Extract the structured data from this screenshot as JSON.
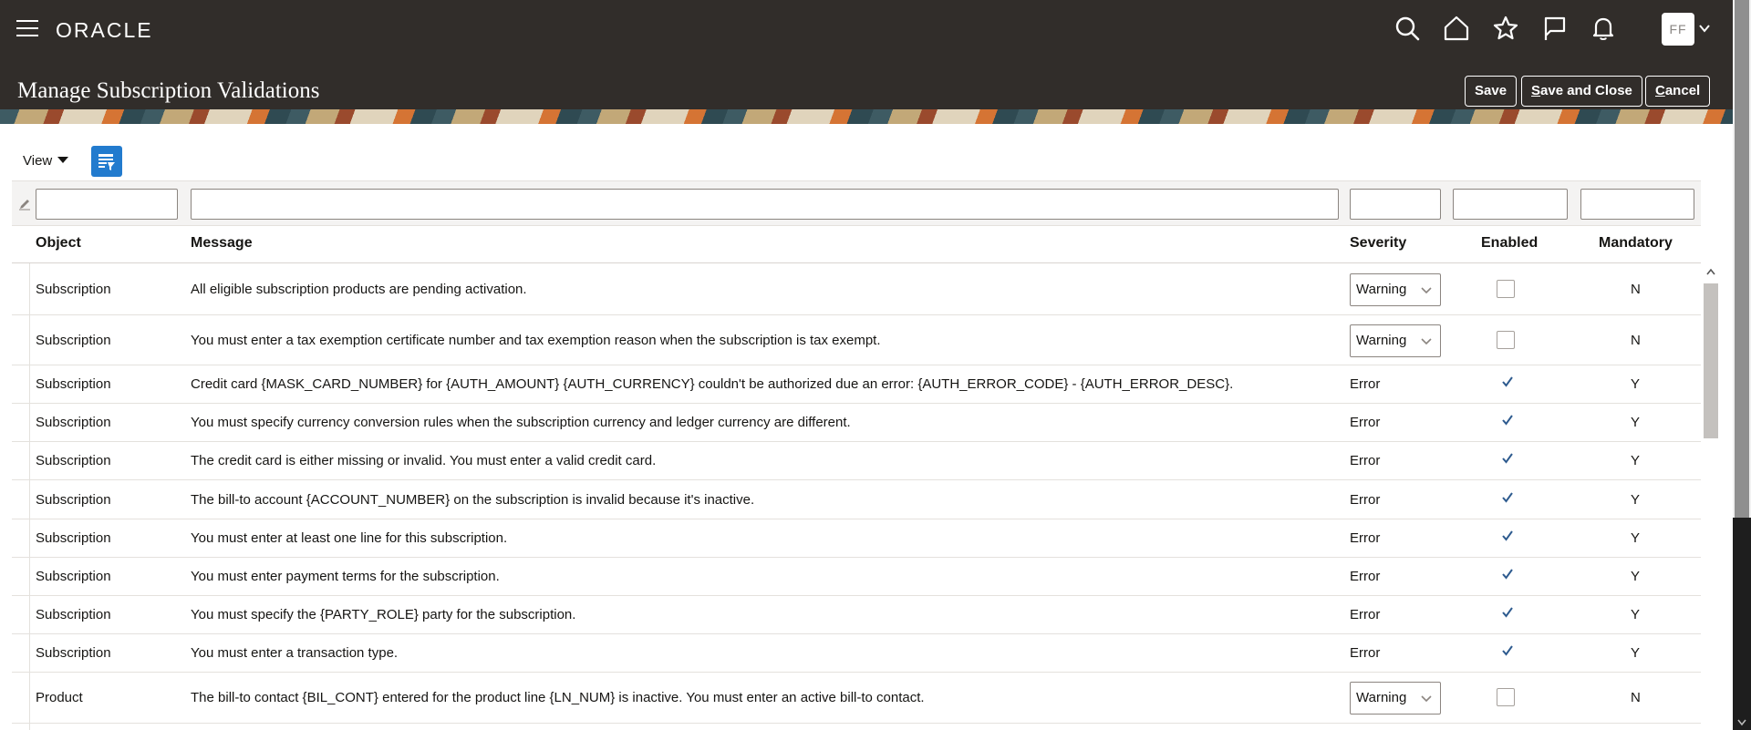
{
  "header": {
    "logo_text": "ORACLE",
    "page_title": "Manage Subscription Validations",
    "avatar_initials": "FF",
    "buttons": {
      "save": "Save",
      "save_and_close_first": "S",
      "save_and_close_rest": "ave and Close",
      "cancel_first": "C",
      "cancel_rest": "ancel"
    },
    "icons": [
      "menu-icon",
      "search-icon",
      "home-icon",
      "favorites-star-icon",
      "flag-icon",
      "notifications-bell-icon",
      "chevron-down-icon"
    ]
  },
  "toolbar": {
    "view_label": "View",
    "freeze_icon": "freeze-columns-icon"
  },
  "table": {
    "columns": {
      "object": "Object",
      "message": "Message",
      "severity": "Severity",
      "enabled": "Enabled",
      "mandatory": "Mandatory"
    },
    "filters": {
      "object": "",
      "message": "",
      "severity": "",
      "enabled": "",
      "mandatory": ""
    },
    "rows": [
      {
        "object": "Subscription",
        "message": "All eligible subscription products are pending activation.",
        "severity": "Warning",
        "severity_editable": true,
        "enabled": false,
        "mandatory": "N"
      },
      {
        "object": "Subscription",
        "message": "You must enter a tax exemption certificate number and tax exemption reason when the subscription is tax exempt.",
        "severity": "Warning",
        "severity_editable": true,
        "enabled": false,
        "mandatory": "N"
      },
      {
        "object": "Subscription",
        "message": "Credit card {MASK_CARD_NUMBER} for {AUTH_AMOUNT} {AUTH_CURRENCY} couldn't be authorized due an error: {AUTH_ERROR_CODE} - {AUTH_ERROR_DESC}.",
        "severity": "Error",
        "severity_editable": false,
        "enabled": true,
        "mandatory": "Y"
      },
      {
        "object": "Subscription",
        "message": "You must specify currency conversion rules when the subscription currency and ledger currency are different.",
        "severity": "Error",
        "severity_editable": false,
        "enabled": true,
        "mandatory": "Y"
      },
      {
        "object": "Subscription",
        "message": "The credit card is either missing or invalid. You must enter a valid credit card.",
        "severity": "Error",
        "severity_editable": false,
        "enabled": true,
        "mandatory": "Y"
      },
      {
        "object": "Subscription",
        "message": "The bill-to account {ACCOUNT_NUMBER} on the subscription is invalid because it's inactive.",
        "severity": "Error",
        "severity_editable": false,
        "enabled": true,
        "mandatory": "Y"
      },
      {
        "object": "Subscription",
        "message": "You must enter at least one line for this subscription.",
        "severity": "Error",
        "severity_editable": false,
        "enabled": true,
        "mandatory": "Y"
      },
      {
        "object": "Subscription",
        "message": "You must enter payment terms for the subscription.",
        "severity": "Error",
        "severity_editable": false,
        "enabled": true,
        "mandatory": "Y"
      },
      {
        "object": "Subscription",
        "message": "You must specify the {PARTY_ROLE} party for the subscription.",
        "severity": "Error",
        "severity_editable": false,
        "enabled": true,
        "mandatory": "Y"
      },
      {
        "object": "Subscription",
        "message": "You must enter a transaction type.",
        "severity": "Error",
        "severity_editable": false,
        "enabled": true,
        "mandatory": "Y"
      },
      {
        "object": "Product",
        "message": "The bill-to contact {BIL_CONT} entered for the product line {LN_NUM} is inactive. You must enter an active bill-to contact.",
        "severity": "Warning",
        "severity_editable": true,
        "enabled": false,
        "mandatory": "N"
      }
    ]
  },
  "colors": {
    "header_bg": "#312d2a",
    "accent_blue": "#227bce",
    "checkmark": "#2e5b8f"
  }
}
